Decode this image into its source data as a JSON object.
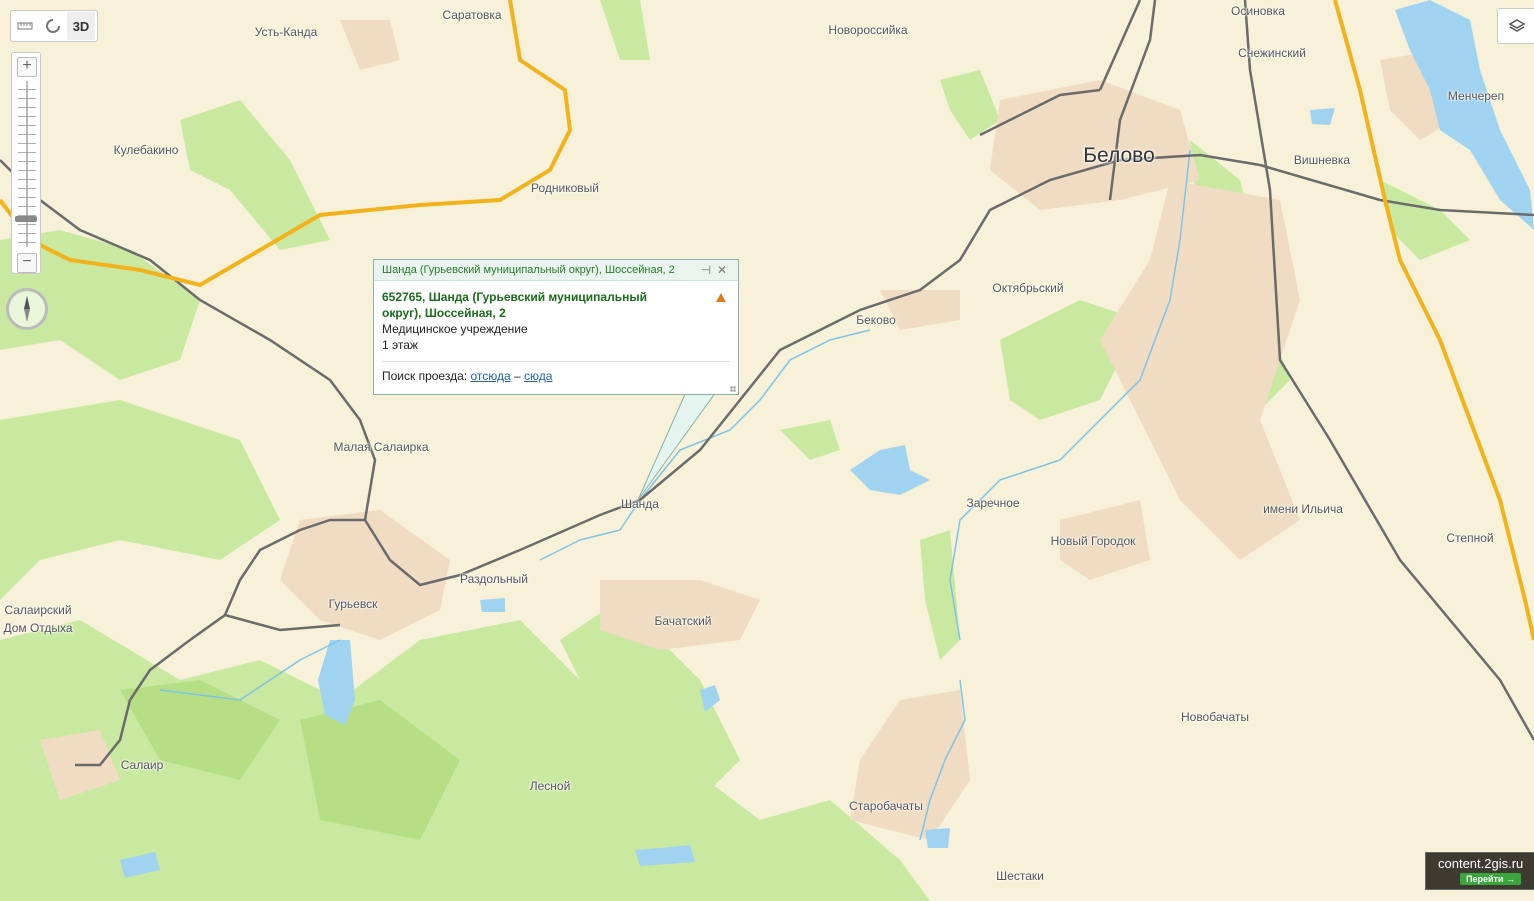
{
  "map": {
    "colors": {
      "land": "#f6f1d8",
      "forest": "#c9e9a0",
      "forest_dark": "#b6df85",
      "settlement": "#efdcc2",
      "water": "#9fd3f0",
      "river": "#7fc3e6",
      "highway": "#f2b21c",
      "road": "#6b6b6b"
    },
    "places": [
      {
        "name": "Саратовка"
      },
      {
        "name": "Усть-Канда"
      },
      {
        "name": "Новороссийка"
      },
      {
        "name": "Осиновка"
      },
      {
        "name": "Снежинский"
      },
      {
        "name": "Менчереп"
      },
      {
        "name": "Кулебакино"
      },
      {
        "name": "Белово"
      },
      {
        "name": "Вишневка"
      },
      {
        "name": "Родниковый"
      },
      {
        "name": "Октябрьский"
      },
      {
        "name": "Беково"
      },
      {
        "name": "Малая Салаирка"
      },
      {
        "name": "Шанда"
      },
      {
        "name": "Заречное"
      },
      {
        "name": "имени Ильича"
      },
      {
        "name": "Новый Городок"
      },
      {
        "name": "Степной"
      },
      {
        "name": "Раздольный"
      },
      {
        "name": "Гурьевск"
      },
      {
        "name": "Бачатский"
      },
      {
        "name": "Салаирский Дом Отдыха"
      },
      {
        "name": "Новобачаты"
      },
      {
        "name": "Салаир"
      },
      {
        "name": "Лесной"
      },
      {
        "name": "Старобачаты"
      },
      {
        "name": "Шестаки"
      }
    ]
  },
  "toolbar": {
    "ruler_icon": "ruler-icon",
    "measure_icon": "area-icon",
    "btn_3d": "3D"
  },
  "zoom": {
    "plus": "+",
    "minus": "−",
    "level": 0.17
  },
  "layers_icon": "layers-icon",
  "popup": {
    "header": "Шанда (Гурьевский муниципальный округ), Шоссейная, 2",
    "address": "652765, Шанда (Гурьевский муниципальный округ), Шоссейная, 2",
    "category": "Медицинское учреждение",
    "floor": "1 этаж",
    "route_label": "Поиск проезда:",
    "route_from": "отсюда",
    "route_dash": "–",
    "route_to": "сюда"
  },
  "ad": {
    "title": "content.2gis.ru",
    "button": "Перейти →"
  }
}
